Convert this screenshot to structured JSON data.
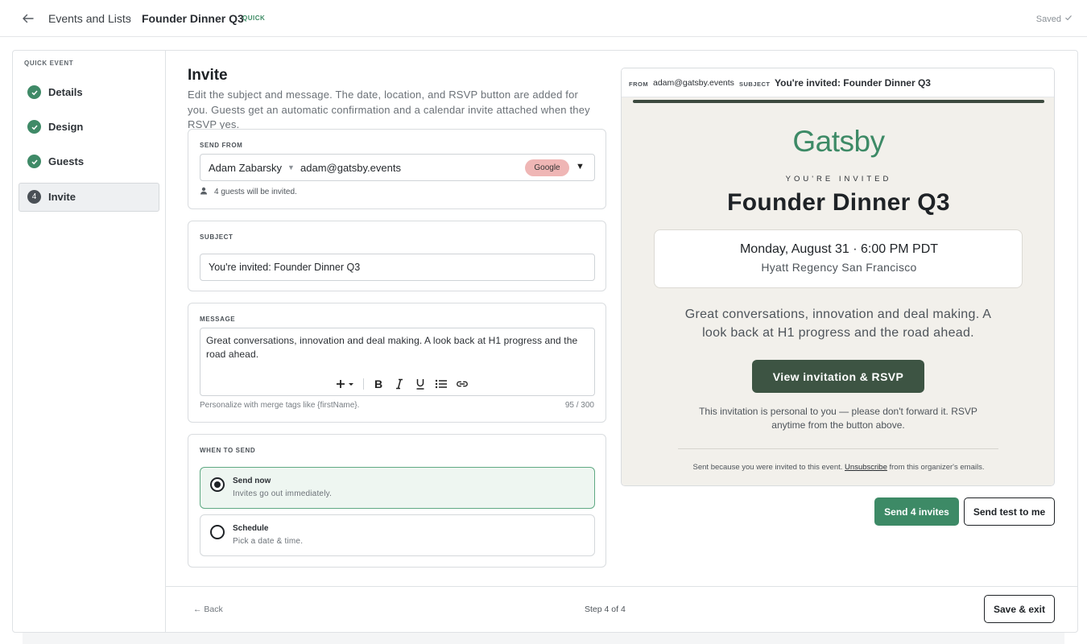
{
  "header": {
    "breadcrumb_root": "Events and Lists",
    "breadcrumb_sep": "›",
    "breadcrumb_current": "Founder Dinner Q3",
    "badge": "QUICK",
    "saved_label": "Saved"
  },
  "sidebar": {
    "section_label": "QUICK EVENT",
    "steps": [
      {
        "label": "Details",
        "state": "done"
      },
      {
        "label": "Design",
        "state": "done"
      },
      {
        "label": "Guests",
        "state": "done"
      },
      {
        "label": "Invite",
        "state": "active",
        "number": "4"
      }
    ]
  },
  "main": {
    "title": "Invite",
    "description": "Edit the subject and message. The date, location, and RSVP button are added for you. Guests get an automatic confirmation and a calendar invite attached when they RSVP yes.",
    "send_from": {
      "label": "SEND FROM",
      "sender_name": "Adam Zabarsky",
      "sender_email": "adam@gatsby.events",
      "provider": "Google",
      "guest_note": "4 guests will be invited."
    },
    "subject": {
      "label": "SUBJECT",
      "value": "You're invited: Founder Dinner Q3"
    },
    "message": {
      "label": "MESSAGE",
      "value": "Great conversations, innovation and deal making. A look back at H1 progress and the road ahead.",
      "hint": "Personalize with merge tags like {firstName}.",
      "count": "95 / 300"
    },
    "when_to_send": {
      "label": "WHEN TO SEND",
      "options": [
        {
          "title": "Send now",
          "subtitle": "Invites go out immediately.",
          "selected": true
        },
        {
          "title": "Schedule",
          "subtitle": "Pick a date & time.",
          "selected": false
        }
      ]
    }
  },
  "preview": {
    "from_label": "FROM",
    "from": "adam@gatsby.events",
    "subject_label": "SUBJECT",
    "subject": "You're invited: Founder Dinner Q3",
    "brand": "Gatsby",
    "kicker": "YOU'RE INVITED",
    "event_title": "Founder Dinner Q3",
    "date_line": "Monday, August 31 · 6:00 PM PDT",
    "venue": "Hyatt Regency San Francisco",
    "message": "Great conversations, innovation and deal making. A look back at H1 progress and the road ahead.",
    "cta": "View invitation & RSVP",
    "personal_note": "This invitation is personal to you — please don't forward it. RSVP anytime from the button above.",
    "footer_pre": "Sent because you were invited to this event.",
    "footer_link": "Unsubscribe",
    "footer_post": "from this organizer's emails."
  },
  "actions": {
    "send_invites": "Send 4 invites",
    "send_test": "Send test to me"
  },
  "footer": {
    "back": "← Back",
    "step": "Step 4 of 4",
    "save_exit": "Save & exit"
  },
  "colors": {
    "accent_green": "#3d8a66",
    "cta_dark_green": "#3d5443",
    "provider_pill": "#efb6b5"
  }
}
